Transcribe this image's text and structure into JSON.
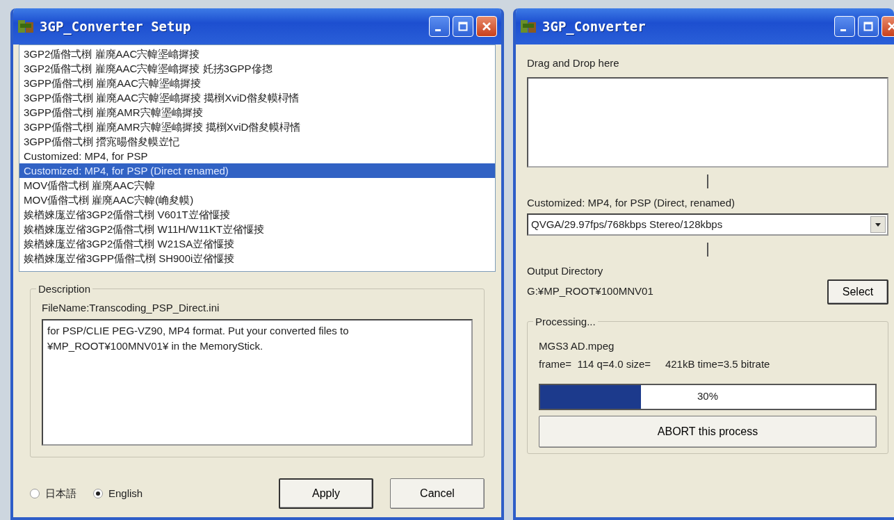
{
  "setup_window": {
    "title": "3GP_Converter Setup",
    "presets": [
      {
        "label": "3GP2偱偺弌椡 嵟廃AAC宍幃埿嶖摨掕",
        "selected": false
      },
      {
        "label": "3GP2偱偺弌椡 嵟廃AAC宍幃埿嶖摨掕 奼挘3GPP傪揔",
        "selected": false
      },
      {
        "label": "3GPP偱偺弌椡 嵟廃AAC宍幃埿嶖摨掕",
        "selected": false
      },
      {
        "label": "3GPP偱偺弌椡 嵟廃AAC宍幃埿嶖摨掕 擖椡XviD偺夋幙桪愭",
        "selected": false
      },
      {
        "label": "3GPP偱偺弌椡 嵟廃AMR宍幃埿嶖摨掕",
        "selected": false
      },
      {
        "label": "3GPP偱偺弌椡 嵟廃AMR宍幃埿嶖摨掕 擖椡XviD偺夋幙桪愭",
        "selected": false
      },
      {
        "label": "3GPP偱偺弌椡 攚宨晹偺夋幙岦忋",
        "selected": false
      },
      {
        "label": "Customized: MP4, for PSP",
        "selected": false
      },
      {
        "label": "Customized: MP4, for PSP (Direct renamed)",
        "selected": true
      },
      {
        "label": "MOV偱偺弌椡 嵟廃AAC宍幃",
        "selected": false
      },
      {
        "label": "MOV偱偺弌椡 嵟廃AAC宍幃(崅夋幙)",
        "selected": false
      },
      {
        "label": "娭楢婡庬岦偗3GP2偱偺弌椡 V601T岦偗愝掕",
        "selected": false
      },
      {
        "label": "娭楢婡庬岦偗3GP2偱偺弌椡 W11H/W11KT岦偗愝掕",
        "selected": false
      },
      {
        "label": "娭楢婡庬岦偗3GP2偱偺弌椡 W21SA岦偗愝掕",
        "selected": false
      },
      {
        "label": "娭楢婡庬岦偗3GPP偱偺弌椡 SH900i岦偗愝掕",
        "selected": false
      }
    ],
    "description": {
      "legend": "Description",
      "filename": "FileName:Transcoding_PSP_Direct.ini",
      "text": "for PSP/CLIE PEG-VZ90, MP4 format. Put your converted files to ¥MP_ROOT¥100MNV01¥ in the MemoryStick."
    },
    "languages": [
      {
        "label": "日本語",
        "selected": false
      },
      {
        "label": "English",
        "selected": true
      }
    ],
    "buttons": [
      {
        "label": "Apply",
        "default": true
      },
      {
        "label": "Cancel",
        "default": false
      }
    ]
  },
  "converter_window": {
    "title": "3GP_Converter",
    "drop_label": "Drag and Drop here",
    "preset_label": "Customized: MP4, for PSP (Direct, renamed)",
    "quality": "QVGA/29.97fps/768kbps Stereo/128kbps",
    "output_label": "Output Directory",
    "output_path": "G:¥MP_ROOT¥100MNV01",
    "select_button": "Select",
    "processing": {
      "legend": "Processing...",
      "file": "MGS3 AD.mpeg",
      "stats": "frame=  114 q=4.0 size=     421kB time=3.5 bitrate",
      "level": 0.3,
      "reading": "30%",
      "abort_button": "ABORT this process"
    }
  }
}
